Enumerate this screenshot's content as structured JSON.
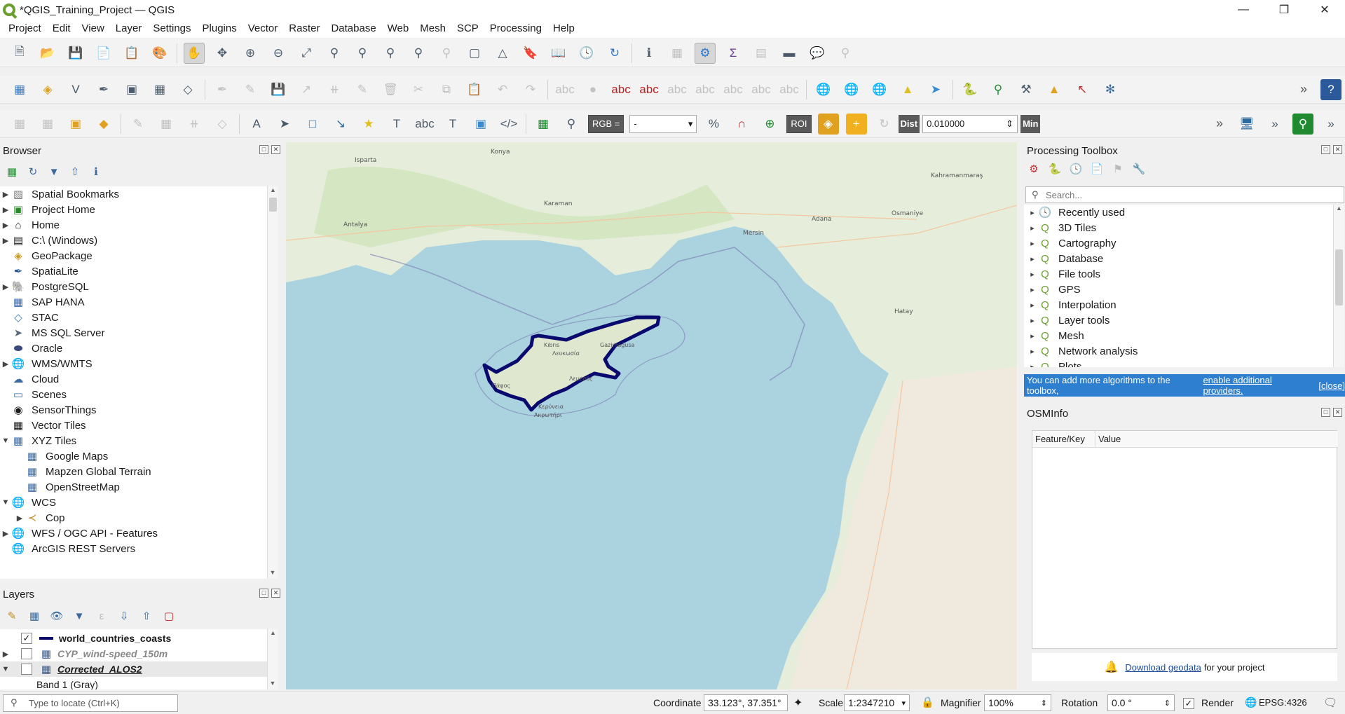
{
  "window": {
    "title": "*QGIS_Training_Project — QGIS"
  },
  "menu": [
    "Project",
    "Edit",
    "View",
    "Layer",
    "Settings",
    "Plugins",
    "Vector",
    "Raster",
    "Database",
    "Web",
    "Mesh",
    "SCP",
    "Processing",
    "Help"
  ],
  "toolbar3": {
    "rgb_label": "RGB =",
    "rgb_value": "-",
    "roi_label": "ROI",
    "dist_label": "Dist",
    "dist_value": "0.010000",
    "min_label": "Min"
  },
  "browser": {
    "title": "Browser",
    "items": [
      {
        "label": "Spatial Bookmarks",
        "icon": "bookmark-icon",
        "level": 0,
        "arrow": "▶"
      },
      {
        "label": "Project Home",
        "icon": "project-home-icon",
        "level": 0,
        "arrow": "▶"
      },
      {
        "label": "Home",
        "icon": "home-folder-icon",
        "level": 0,
        "arrow": "▶"
      },
      {
        "label": "C:\\ (Windows)",
        "icon": "drive-icon",
        "level": 0,
        "arrow": "▶"
      },
      {
        "label": "GeoPackage",
        "icon": "geopackage-icon",
        "level": 0,
        "arrow": ""
      },
      {
        "label": "SpatiaLite",
        "icon": "spatialite-icon",
        "level": 0,
        "arrow": ""
      },
      {
        "label": "PostgreSQL",
        "icon": "postgresql-icon",
        "level": 0,
        "arrow": "▶"
      },
      {
        "label": "SAP HANA",
        "icon": "sap-hana-icon",
        "level": 0,
        "arrow": ""
      },
      {
        "label": "STAC",
        "icon": "stac-icon",
        "level": 0,
        "arrow": ""
      },
      {
        "label": "MS SQL Server",
        "icon": "mssql-icon",
        "level": 0,
        "arrow": ""
      },
      {
        "label": "Oracle",
        "icon": "oracle-icon",
        "level": 0,
        "arrow": ""
      },
      {
        "label": "WMS/WMTS",
        "icon": "wms-icon",
        "level": 0,
        "arrow": "▶"
      },
      {
        "label": "Cloud",
        "icon": "cloud-icon",
        "level": 0,
        "arrow": ""
      },
      {
        "label": "Scenes",
        "icon": "scenes-icon",
        "level": 0,
        "arrow": ""
      },
      {
        "label": "SensorThings",
        "icon": "sensorthings-icon",
        "level": 0,
        "arrow": ""
      },
      {
        "label": "Vector Tiles",
        "icon": "vector-tiles-icon",
        "level": 0,
        "arrow": ""
      },
      {
        "label": "XYZ Tiles",
        "icon": "xyz-tiles-icon",
        "level": 0,
        "arrow": "▼"
      },
      {
        "label": "Google Maps",
        "icon": "tile-layer-icon",
        "level": 1,
        "arrow": ""
      },
      {
        "label": "Mapzen Global Terrain",
        "icon": "tile-layer-icon",
        "level": 1,
        "arrow": ""
      },
      {
        "label": "OpenStreetMap",
        "icon": "tile-layer-icon",
        "level": 1,
        "arrow": ""
      },
      {
        "label": "WCS",
        "icon": "wcs-icon",
        "level": 0,
        "arrow": "▼"
      },
      {
        "label": "Cop",
        "icon": "wcs-connection-icon",
        "level": 1,
        "arrow": "▶"
      },
      {
        "label": "WFS / OGC API - Features",
        "icon": "wfs-icon",
        "level": 0,
        "arrow": "▶"
      },
      {
        "label": "ArcGIS REST Servers",
        "icon": "arcgis-icon",
        "level": 0,
        "arrow": ""
      }
    ]
  },
  "layers": {
    "title": "Layers",
    "items": [
      {
        "label": "world_countries_coasts",
        "checked": "✓",
        "arrow": "",
        "style": "bold",
        "icon": "line-symbol-icon"
      },
      {
        "label": "CYP_wind-speed_150m",
        "checked": "",
        "arrow": "▶",
        "style": "italic-gray",
        "icon": "raster-icon"
      },
      {
        "label": "Corrected_ALOS2",
        "checked": "",
        "arrow": "▼",
        "style": "bold-italic",
        "icon": "raster-icon"
      },
      {
        "label": "Band 1 (Gray)",
        "checked": "",
        "arrow": "",
        "style": "plain",
        "icon": ""
      }
    ]
  },
  "map": {
    "labels": [
      {
        "text": "Konya",
        "cls": "city"
      },
      {
        "text": "Isparta",
        "cls": "city"
      },
      {
        "text": "Antalya",
        "cls": "city"
      },
      {
        "text": "Karaman",
        "cls": "city"
      },
      {
        "text": "Adana",
        "cls": "city"
      },
      {
        "text": "Osmaniye",
        "cls": "city"
      },
      {
        "text": "Mersin",
        "cls": "city"
      },
      {
        "text": "Kahramanmaraş",
        "cls": "city"
      },
      {
        "text": "Hatay",
        "cls": "city"
      },
      {
        "text": "Κερύνεια",
        "cls": "city"
      },
      {
        "text": "Kıbrıs",
        "cls": "city"
      },
      {
        "text": "Λευκωσία",
        "cls": "city"
      },
      {
        "text": "Gazimağusa",
        "cls": "city"
      },
      {
        "text": "Πάφος",
        "cls": "city"
      },
      {
        "text": "Λεμεσός",
        "cls": "city"
      },
      {
        "text": "Ακρωτήρι",
        "cls": "city"
      }
    ]
  },
  "processing": {
    "title": "Processing Toolbox",
    "search_placeholder": "Search...",
    "items": [
      "Recently used",
      "3D Tiles",
      "Cartography",
      "Database",
      "File tools",
      "GPS",
      "Interpolation",
      "Layer tools",
      "Mesh",
      "Network analysis",
      "Plots"
    ],
    "notice_text": "You can add more algorithms to the toolbox,",
    "notice_link": "enable additional providers.",
    "notice_close": "[close]"
  },
  "osminfo": {
    "title": "OSMInfo",
    "col1": "Feature/Key",
    "col2": "Value",
    "download_link": "Download geodata",
    "download_suffix": "for your project"
  },
  "status": {
    "locate_placeholder": "Type to locate (Ctrl+K)",
    "coordinate_label": "Coordinate",
    "coordinate_value": "33.123°, 37.351°",
    "scale_label": "Scale",
    "scale_value": "1:2347210",
    "magnifier_label": "Magnifier",
    "magnifier_value": "100%",
    "rotation_label": "Rotation",
    "rotation_value": "0.0 °",
    "render_label": "Render",
    "crs": "EPSG:4326"
  },
  "colors": {
    "sea": "#aad3df",
    "land": "#f2efe9",
    "coast": "#0a0a6e",
    "accent": "#2e7fd0"
  }
}
